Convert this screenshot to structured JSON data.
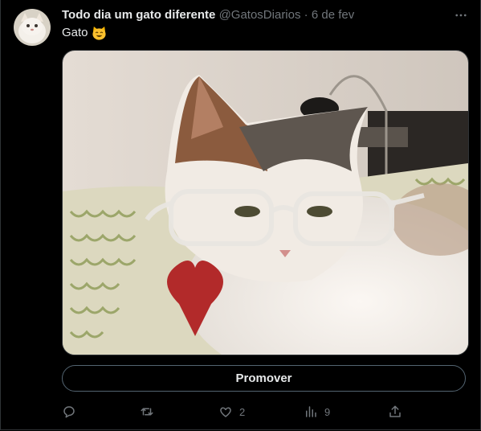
{
  "tweet": {
    "author_name": "Todo dia um gato diferente",
    "handle": "@GatosDiarios",
    "separator": " · ",
    "date": "6 de fev",
    "text": "Gato",
    "emoji": "😺"
  },
  "promote_label": "Promover",
  "actions": {
    "reply_count": "",
    "retweet_count": "",
    "like_count": "2",
    "views_count": "9"
  },
  "icons": {
    "more": "more-horizontal-icon",
    "reply": "reply-icon",
    "retweet": "retweet-icon",
    "like": "heart-icon",
    "views": "analytics-icon",
    "share": "share-icon"
  },
  "colors": {
    "background": "#000000",
    "text": "#e7e9ea",
    "muted": "#71767b",
    "border": "#2f3336",
    "button_border": "#536471"
  }
}
